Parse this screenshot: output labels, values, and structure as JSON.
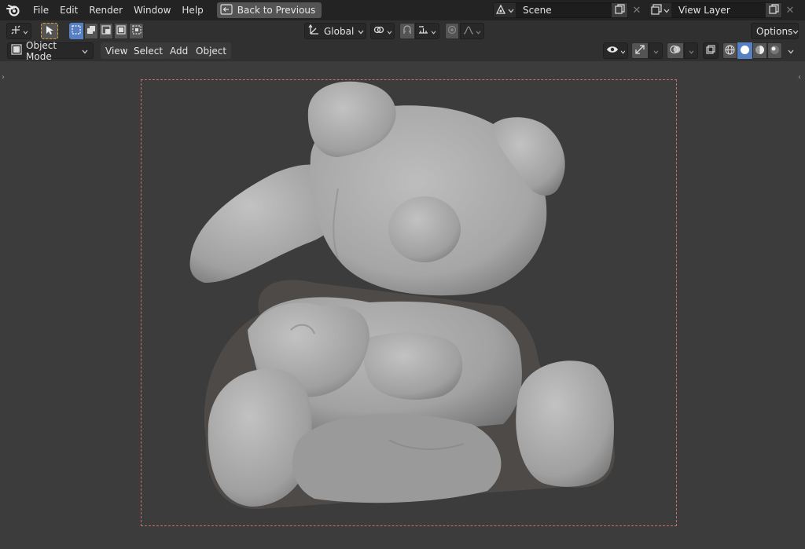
{
  "menu": {
    "file": "File",
    "edit": "Edit",
    "render": "Render",
    "window": "Window",
    "help": "Help",
    "back_to_previous": "Back to Previous"
  },
  "scene": {
    "name": "Scene"
  },
  "view_layer": {
    "name": "View Layer"
  },
  "tool_header": {
    "orientation": "Global",
    "options": "Options"
  },
  "viewport_header": {
    "mode": "Object Mode",
    "view": "View",
    "select": "Select",
    "add": "Add",
    "object": "Object"
  },
  "colors": {
    "topbar_bg": "#232323",
    "header_bg": "#303030",
    "viewport_bg": "#3c3c3c",
    "active_accent": "#5680c2",
    "camera_frame": "#c96e6e",
    "tool_active_outline": "#e0a235"
  },
  "icons": {
    "app_logo": "blender-logo-icon",
    "back": "back-to-previous-icon",
    "scene": "scene-icon",
    "view_layer": "view-layer-icon",
    "transform": "transform-pivot-icon",
    "select_tool": "cursor-select-icon",
    "snap": "snap-magnet-icon",
    "proportional": "proportional-editing-icon",
    "visibility": "eye-icon",
    "gizmo": "gizmo-icon",
    "overlay": "overlay-icon",
    "xray": "xray-icon",
    "shading": [
      "wireframe-shading-icon",
      "solid-shading-icon",
      "material-shading-icon",
      "rendered-shading-icon"
    ]
  }
}
